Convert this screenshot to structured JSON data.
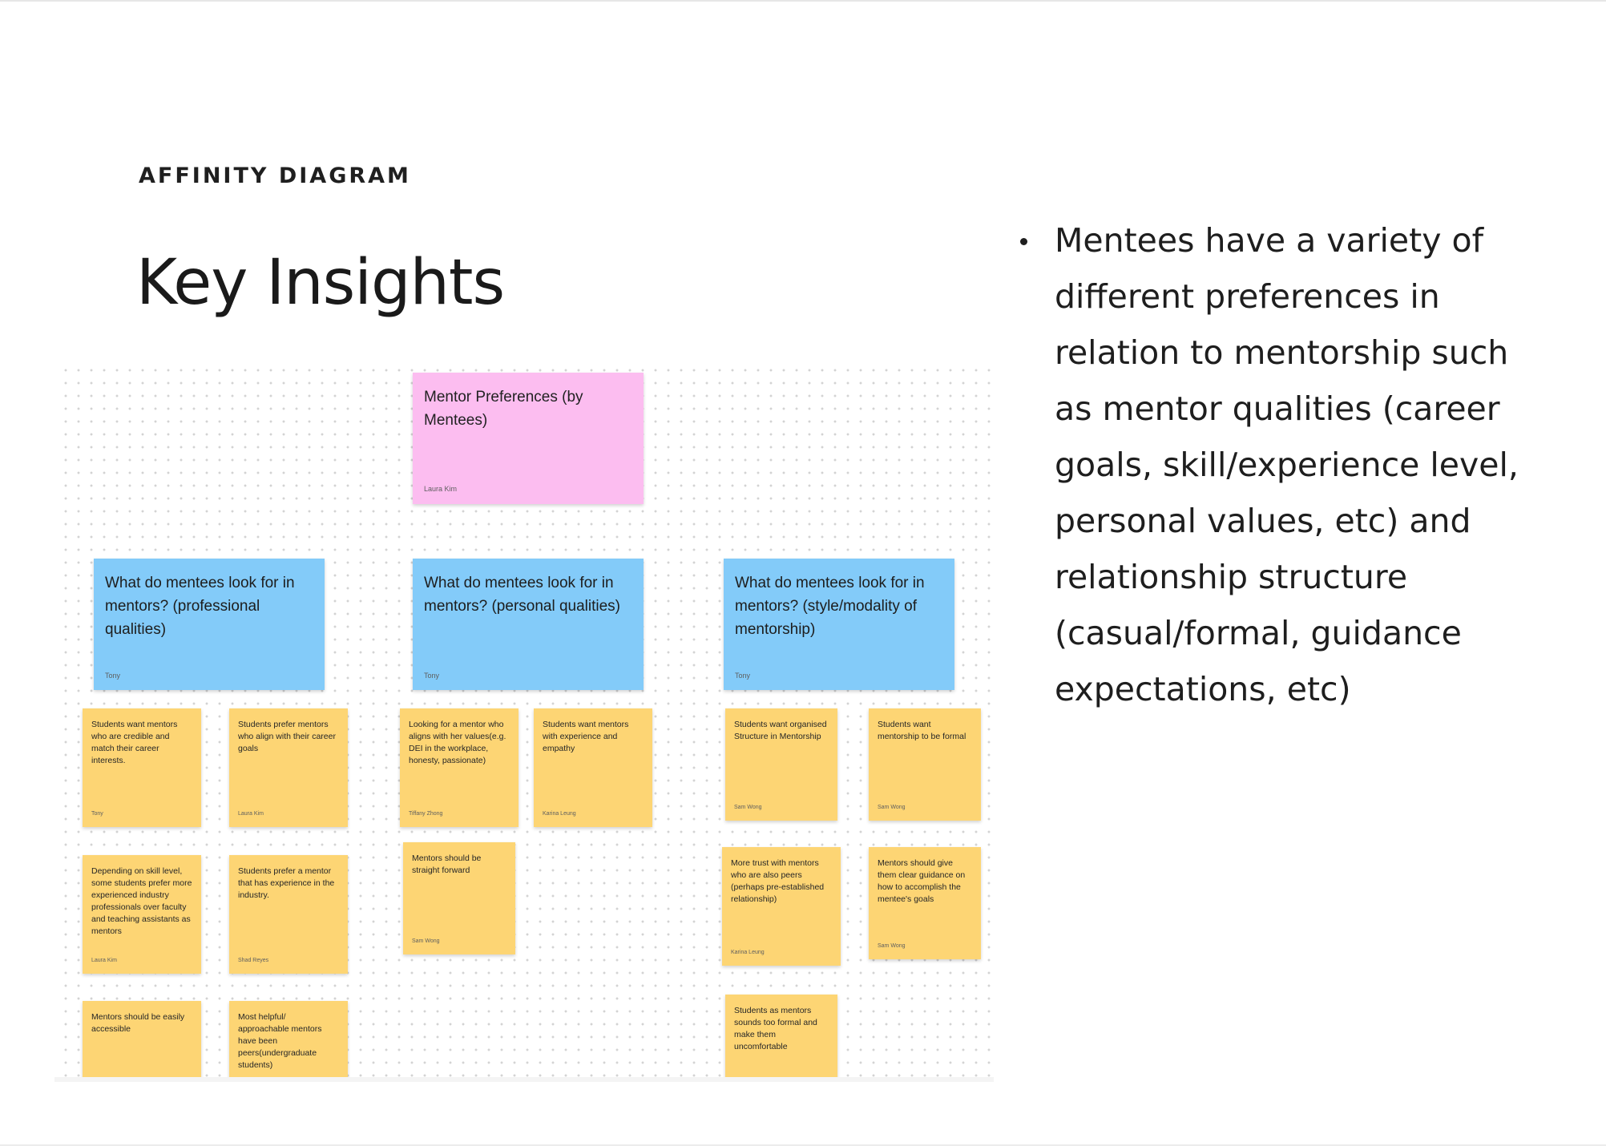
{
  "slide": {
    "eyebrow": "AFFINITY DIAGRAM",
    "title": "Key Insights"
  },
  "board": {
    "header": {
      "text": "Mentor Preferences (by Mentees)",
      "author": "Laura Kim",
      "color": "#fcbdf0"
    },
    "categories": [
      {
        "text": "What do mentees look for in mentors? (professional qualities)",
        "author": "Tony",
        "color": "#83cbf9",
        "notes": [
          {
            "text": "Students want mentors who are credible and match their career interests.",
            "author": "Tony"
          },
          {
            "text": "Students prefer mentors who align with their career goals",
            "author": "Laura Kim"
          },
          {
            "text": "Depending on skill level, some students prefer more experienced industry professionals over faculty and teaching assistants as mentors",
            "author": "Laura Kim"
          },
          {
            "text": "Students prefer a mentor that has experience in the industry.",
            "author": "Shad Reyes"
          },
          {
            "text": "Mentors should be easily accessible",
            "author": ""
          },
          {
            "text": "Most helpful/ approachable mentors have been peers(undergraduate students)",
            "author": ""
          }
        ]
      },
      {
        "text": "What do mentees look for in mentors? (personal qualities)",
        "author": "Tony",
        "color": "#83cbf9",
        "notes": [
          {
            "text": "Looking for a mentor who aligns with her values(e.g. DEI in the workplace, honesty, passionate)",
            "author": "Tiffany Zhong"
          },
          {
            "text": "Students want mentors with experience and empathy",
            "author": "Karina Leung"
          },
          {
            "text": "Mentors should be straight forward",
            "author": "Sam Wong"
          }
        ]
      },
      {
        "text": "What do mentees look for in mentors? (style/modality of mentorship)",
        "author": "Tony",
        "color": "#83cbf9",
        "notes": [
          {
            "text": "Students want organised Structure in Mentorship",
            "author": "Sam Wong"
          },
          {
            "text": "Students want mentorship to be formal",
            "author": "Sam Wong"
          },
          {
            "text": "More trust with mentors who are also peers (perhaps pre-established relationship)",
            "author": "Karina Leung"
          },
          {
            "text": "Mentors should give them clear guidance on how to accomplish the mentee's goals",
            "author": "Sam Wong"
          },
          {
            "text": "Students as mentors sounds too formal and make them uncomfortable",
            "author": ""
          }
        ]
      }
    ],
    "sticky_color": "#fdd574"
  },
  "insights": [
    "Mentees have a variety of different preferences in relation to mentorship such as mentor qualities (career goals, skill/experience level, personal values, etc) and relationship structure (casual/formal, guidance expectations, etc)"
  ]
}
